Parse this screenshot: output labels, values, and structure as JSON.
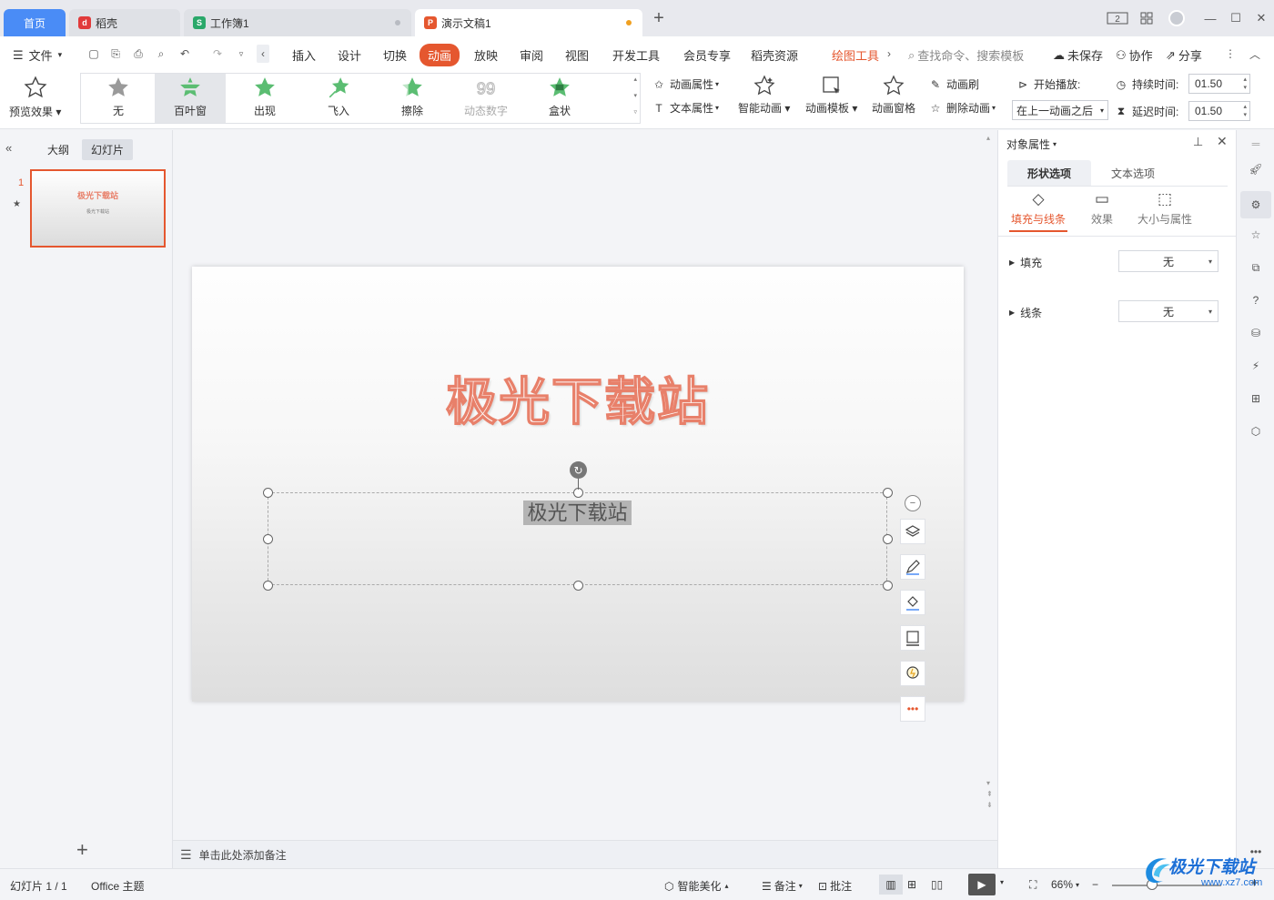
{
  "tabs": {
    "home": "首页",
    "daoke": "稻壳",
    "workbook": "工作簿1",
    "presentation": "演示文稿1"
  },
  "window": {
    "layout_badge": "2"
  },
  "menubar": {
    "file": "文件",
    "items": [
      "插入",
      "设计",
      "切换",
      "动画",
      "放映",
      "审阅",
      "视图",
      "开发工具",
      "会员专享",
      "稻壳资源"
    ],
    "drawing_tools": "绘图工具",
    "search_placeholder": "查找命令、搜索模板",
    "unsaved": "未保存",
    "collab": "协作",
    "share": "分享"
  },
  "ribbon": {
    "preview": "预览效果",
    "gallery": [
      "无",
      "百叶窗",
      "出现",
      "飞入",
      "擦除",
      "动态数字",
      "盒状"
    ],
    "anim_props": "动画属性",
    "text_props": "文本属性",
    "smart_anim": "智能动画",
    "anim_template": "动画模板",
    "anim_pane": "动画窗格",
    "anim_brush": "动画刷",
    "delete_anim": "删除动画",
    "start_play": "开始播放:",
    "start_value": "在上一动画之后",
    "duration_label": "持续时间:",
    "duration_value": "01.50",
    "delay_label": "延迟时间:",
    "delay_value": "01.50"
  },
  "leftpanel": {
    "outline": "大纲",
    "slides": "幻灯片",
    "slide_number": "1",
    "thumb_title": "极光下载站",
    "thumb_sub": "极光下载站"
  },
  "slide": {
    "title": "极光下载站",
    "subtitle": "极光下载站"
  },
  "notes": {
    "placeholder": "单击此处添加备注"
  },
  "rightpanel": {
    "title": "对象属性",
    "tab_shape": "形状选项",
    "tab_text": "文本选项",
    "sub_fill": "填充与线条",
    "sub_effect": "效果",
    "sub_size": "大小与属性",
    "fill_label": "填充",
    "fill_value": "无",
    "line_label": "线条",
    "line_value": "无"
  },
  "statusbar": {
    "slide_count": "幻灯片 1 / 1",
    "theme": "Office 主题",
    "smart_beautify": "智能美化",
    "notes": "备注",
    "comments": "批注",
    "zoom": "66%"
  },
  "watermark": {
    "brand": "极光下载站",
    "url": "www.xz7.com"
  },
  "colors": {
    "accent": "#e5572f",
    "tab_blue": "#4a8cf6",
    "title_outline": "#e8806a",
    "green_star": "#5bbd72"
  }
}
